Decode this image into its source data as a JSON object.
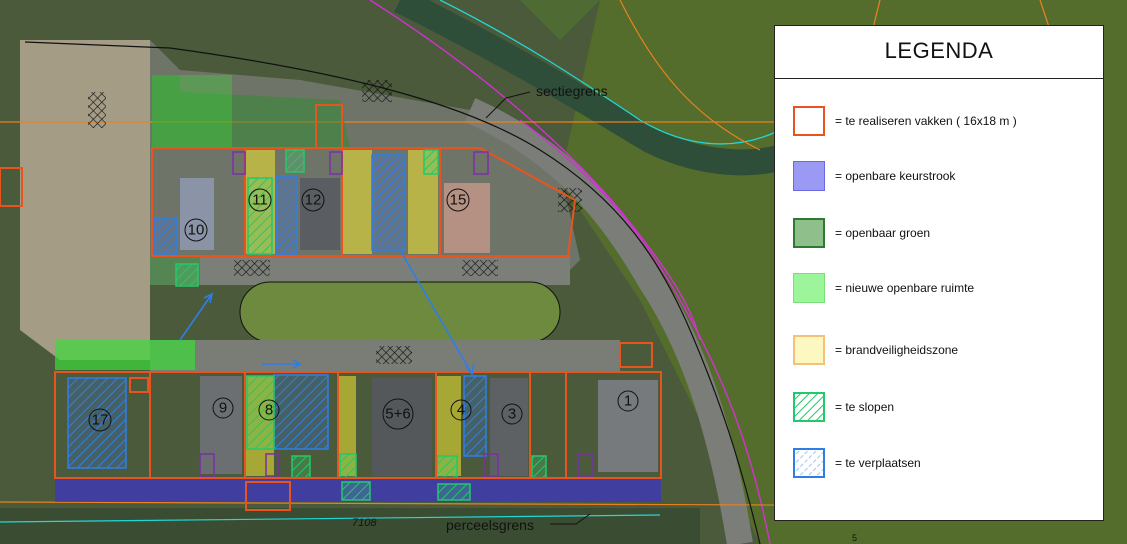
{
  "map": {
    "labels": {
      "sectiegrens": "sectiegrens",
      "perceelsgrens": "perceelsgrens",
      "parcel_code": "7108",
      "small_code": "5"
    },
    "plots": [
      "1",
      "3",
      "4",
      "5+6",
      "8",
      "9",
      "10",
      "11",
      "12",
      "15",
      "17"
    ]
  },
  "legend": {
    "title": "LEGENDA",
    "items": [
      {
        "icon": "orange-outline-square",
        "text": "= te realiseren vakken ( 16x18 m )"
      },
      {
        "icon": "blue-fill-square",
        "text": "= openbare keurstrook"
      },
      {
        "icon": "dark-green-fill-square",
        "text": "= openbaar groen"
      },
      {
        "icon": "light-green-fill-square",
        "text": "= nieuwe openbare ruimte"
      },
      {
        "icon": "yellow-fill-square",
        "text": "= brandveiligheidszone"
      },
      {
        "icon": "green-hatched-square",
        "text": "= te slopen"
      },
      {
        "icon": "blue-hatched-square",
        "text": "= te verplaatsen"
      }
    ]
  },
  "colors": {
    "plot_outline": "#e8541f",
    "keurstrook": "#3a2fd6",
    "openbaar_groen": "#2e8b2e",
    "nieuwe_ruimte": "#3ddc3a",
    "brandzone": "#f2e830",
    "te_slopen": "#22c96a",
    "te_verplaatsen": "#2f7ee8"
  }
}
